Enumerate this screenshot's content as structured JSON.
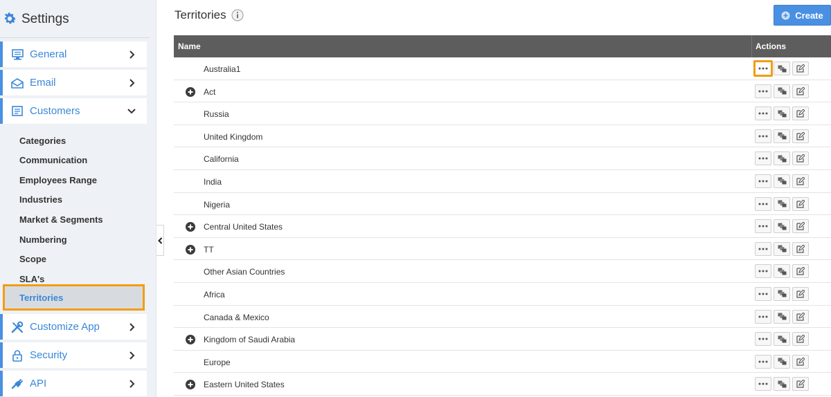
{
  "sidebar": {
    "title": "Settings",
    "items": [
      {
        "label": "General",
        "icon": "monitor-icon"
      },
      {
        "label": "Email",
        "icon": "envelope-icon"
      },
      {
        "label": "Customers",
        "icon": "list-icon"
      },
      {
        "label": "Customize App",
        "icon": "tools-icon"
      },
      {
        "label": "Security",
        "icon": "lock-icon"
      },
      {
        "label": "API",
        "icon": "plug-icon"
      }
    ],
    "sub_items": [
      "Categories",
      "Communication",
      "Employees Range",
      "Industries",
      "Market & Segments",
      "Numbering",
      "Scope",
      "SLA's"
    ],
    "active_sub_item": "Territories"
  },
  "main": {
    "title": "Territories",
    "create_label": "Create",
    "columns": {
      "name": "Name",
      "actions": "Actions"
    },
    "rows": [
      {
        "name": "Australia1",
        "expandable": false
      },
      {
        "name": "Act",
        "expandable": true
      },
      {
        "name": "Russia",
        "expandable": false
      },
      {
        "name": "United Kingdom",
        "expandable": false
      },
      {
        "name": "California",
        "expandable": false
      },
      {
        "name": "India",
        "expandable": false
      },
      {
        "name": "Nigeria",
        "expandable": false
      },
      {
        "name": "Central United States",
        "expandable": true
      },
      {
        "name": "TT",
        "expandable": true
      },
      {
        "name": "Other Asian Countries",
        "expandable": false
      },
      {
        "name": "Africa",
        "expandable": false
      },
      {
        "name": "Canada & Mexico",
        "expandable": false
      },
      {
        "name": "Kingdom of Saudi Arabia",
        "expandable": true
      },
      {
        "name": "Europe",
        "expandable": false
      },
      {
        "name": "Eastern United States",
        "expandable": true
      }
    ]
  },
  "colors": {
    "accent": "#4a90e2",
    "highlight": "#f39c12",
    "table_header": "#5d5d5d",
    "sidebar_bg": "#eef1f5"
  }
}
